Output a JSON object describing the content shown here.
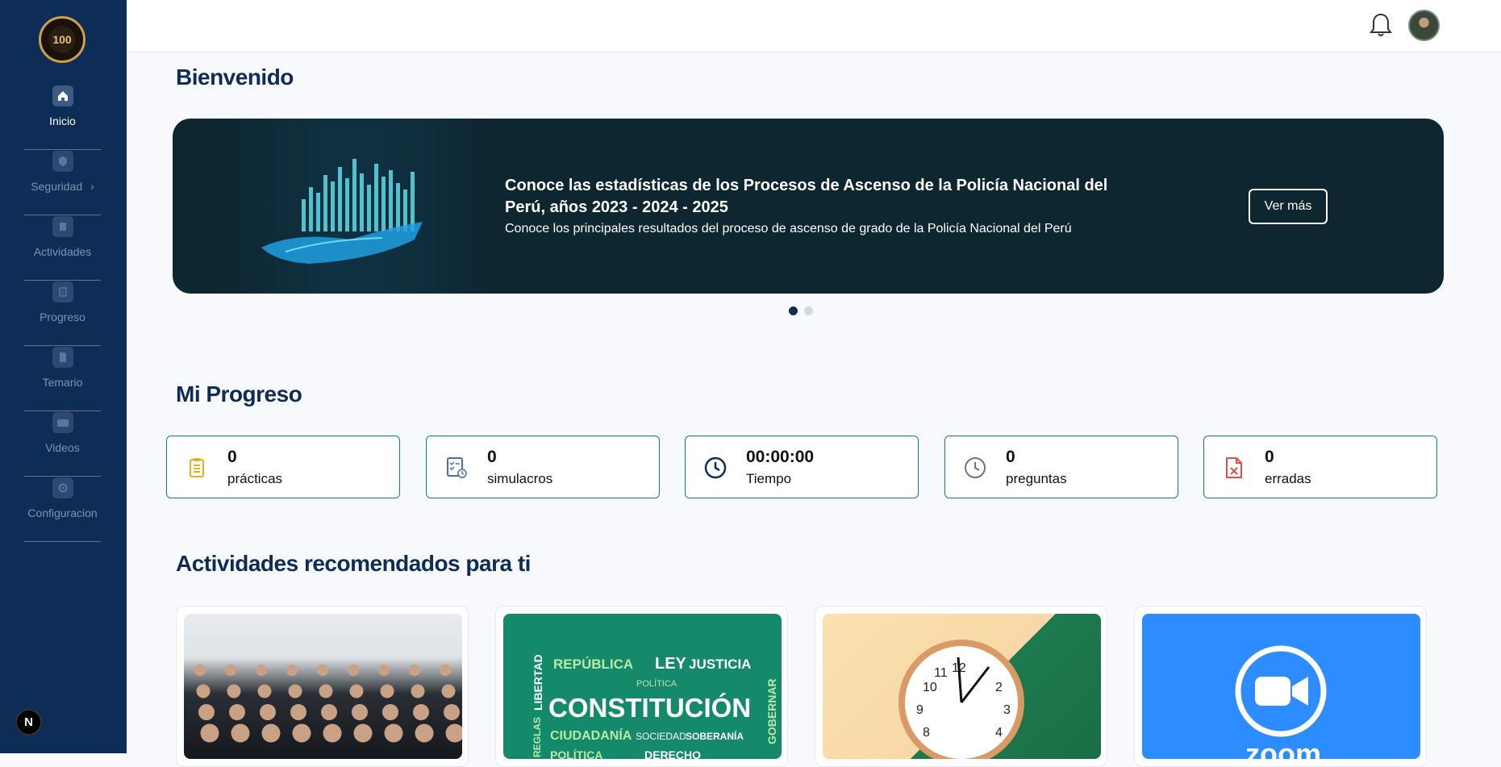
{
  "sidebar": {
    "logo_text": "100",
    "items": [
      {
        "label": "Inicio",
        "active": true,
        "icon": "home-icon"
      },
      {
        "label": "Seguridad",
        "chevron": "›",
        "icon": "shield-icon"
      },
      {
        "label": "Actividades",
        "icon": "activities-icon"
      },
      {
        "label": "Progreso",
        "icon": "progress-icon"
      },
      {
        "label": "Temario",
        "icon": "document-icon"
      },
      {
        "label": "Videos",
        "icon": "video-icon"
      },
      {
        "label": "Configuracion",
        "icon": "gear-icon"
      }
    ],
    "badge": "N"
  },
  "header": {
    "bell_icon": "bell-icon",
    "avatar": "user-avatar"
  },
  "welcome": {
    "title": "Bienvenido"
  },
  "banner": {
    "title": "Conoce las estadísticas de los Procesos de Ascenso de la Policía Nacional del Perú, años 2023 - 2024 - 2025",
    "subtitle": "Conoce los principales resultados del proceso de ascenso de grado de la Policía Nacional del Perú",
    "button": "Ver más"
  },
  "progress": {
    "title": "Mi Progreso",
    "stats": [
      {
        "value": "0",
        "label": "prácticas",
        "icon": "clipboard-icon",
        "color": "#e0b21b"
      },
      {
        "value": "0",
        "label": "simulacros",
        "icon": "checklist-icon",
        "color": "#4a6fa5"
      },
      {
        "value": "00:00:00",
        "label": "Tiempo",
        "icon": "clock-icon",
        "color": "#0d2d57"
      },
      {
        "value": "0",
        "label": "preguntas",
        "icon": "clock-icon",
        "color": "#6b7588"
      },
      {
        "value": "0",
        "label": "erradas",
        "icon": "file-x-icon",
        "color": "#e0504a"
      }
    ]
  },
  "activities": {
    "title": "Actividades recomendados para ti",
    "cards": [
      {
        "image": "classroom-photo"
      },
      {
        "image": "constitution-word-cloud",
        "words": [
          "REPÚBLICA",
          "LEY",
          "JUSTICIA",
          "POLÍTICA",
          "LIBERTAD",
          "CONSTITUCIÓN",
          "GOBERNAR",
          "CIUDADANÍA",
          "SOCIEDAD",
          "SOBERANÍA",
          "REGLAS",
          "POLÍTICA",
          "DERECHO"
        ]
      },
      {
        "image": "wall-clock-photo"
      },
      {
        "image": "zoom-logo",
        "text": "zoom"
      }
    ]
  }
}
